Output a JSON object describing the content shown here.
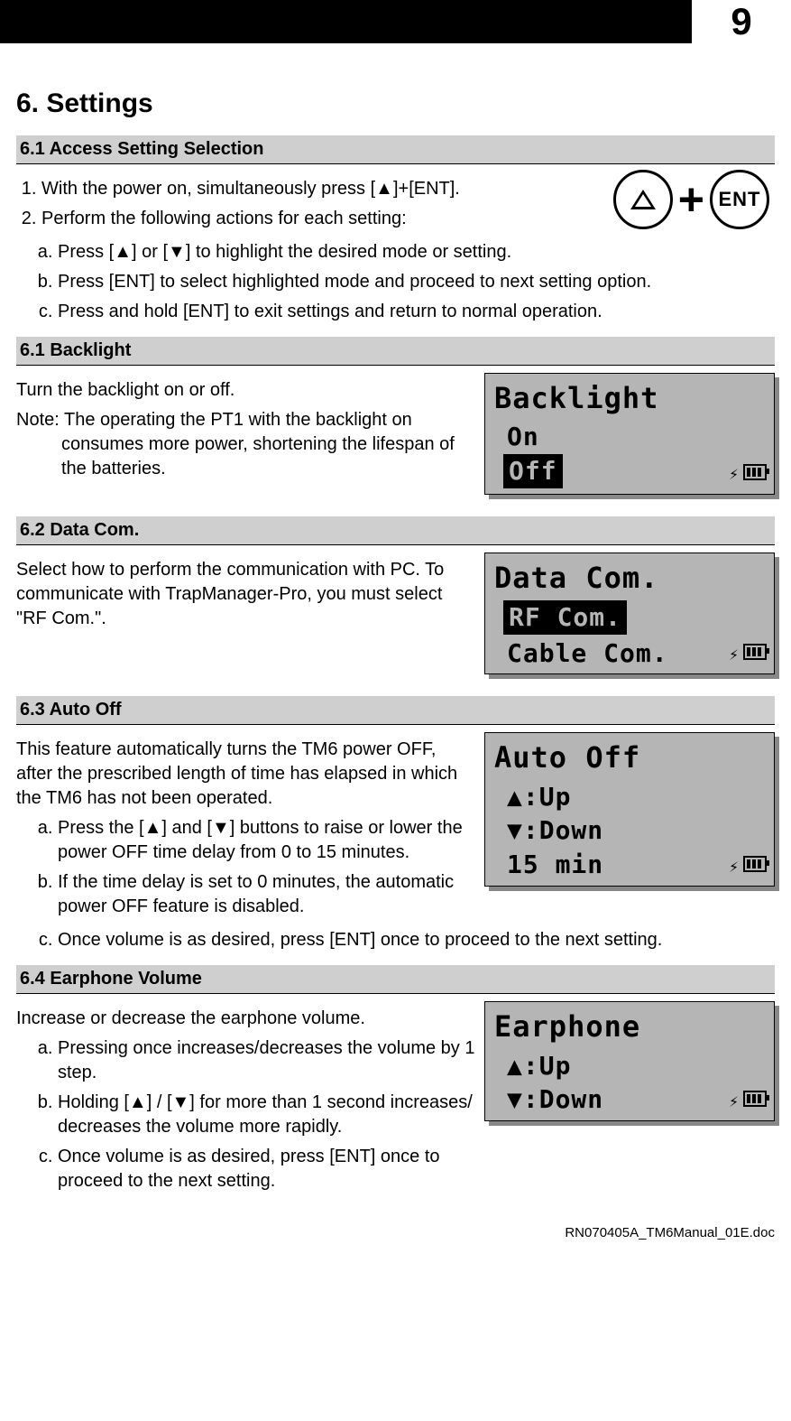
{
  "page_number": "9",
  "heading": "6. Settings",
  "footer": "RN070405A_TM6Manual_01E.doc",
  "icon": {
    "plus": "+",
    "ent": "ENT"
  },
  "s61a": {
    "head": "6.1 Access Setting Selection",
    "step1": "With the power on, simultaneously press [▲]+[ENT].",
    "step2": "Perform the following actions for each setting:",
    "a": "Press [▲] or [▼] to highlight the desired mode or setting.",
    "b": "Press [ENT] to select highlighted mode and proceed to next setting option.",
    "c": "Press and hold [ENT] to exit settings and return to normal operation."
  },
  "s61b": {
    "head": "6.1 Backlight",
    "p1": "Turn the backlight on or off.",
    "note": "Note: The operating the PT1 with the backlight on consumes more power, shortening the lifespan of the batteries.",
    "lcd": {
      "title": "Backlight",
      "opt1": "On",
      "opt2": "Off"
    }
  },
  "s62": {
    "head": "6.2 Data Com.",
    "p1": "Select how to perform the communication with PC. To communicate with TrapManager-Pro, you must select \"RF Com.\".",
    "lcd": {
      "title": "Data Com.",
      "opt1": "RF Com.",
      "opt2": "Cable Com."
    }
  },
  "s63": {
    "head": "6.3 Auto Off",
    "p1": "This feature automatically turns the TM6 power OFF, after the prescribed length of time has elapsed in which the TM6 has not been operated.",
    "a": "Press the [▲] and [▼] buttons to raise or lower the power OFF time delay from 0 to 15 minutes.",
    "b": "If the time delay is set to 0 minutes, the automatic power OFF feature is disabled.",
    "c": "Once volume is as desired, press [ENT] once to proceed to the next setting.",
    "lcd": {
      "title": "Auto Off",
      "l1": "▲:Up",
      "l2": "▼:Down",
      "l3": "15 min"
    }
  },
  "s64": {
    "head": "6.4 Earphone Volume",
    "p1": "Increase or decrease the earphone volume.",
    "a": "Pressing once increases/decreases the volume by 1 step.",
    "b": "Holding [▲] / [▼] for more than 1 second increases/ decreases the volume more rapidly.",
    "c": "Once volume is as desired, press [ENT] once to proceed to the next setting.",
    "lcd": {
      "title": "Earphone",
      "l1": "▲:Up",
      "l2": "▼:Down"
    }
  }
}
